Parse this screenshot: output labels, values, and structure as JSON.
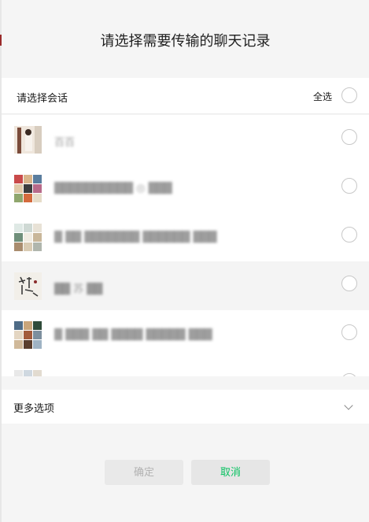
{
  "dialog": {
    "title": "请选择需要传输的聊天记录",
    "select_label": "请选择会话",
    "select_all_label": "全选",
    "more_options_label": "更多选项",
    "confirm_label": "确定",
    "cancel_label": "取消",
    "accent_color": "#07c160"
  },
  "chats": [
    {
      "name": "百百"
    },
    {
      "name": "██████████ ◎ ███"
    },
    {
      "name": "█ ██ ███████ ██████ ███"
    },
    {
      "name": "██ 苏 ██"
    },
    {
      "name": "█ ███ ██ ████ █████ ███"
    },
    {
      "name": ""
    }
  ]
}
